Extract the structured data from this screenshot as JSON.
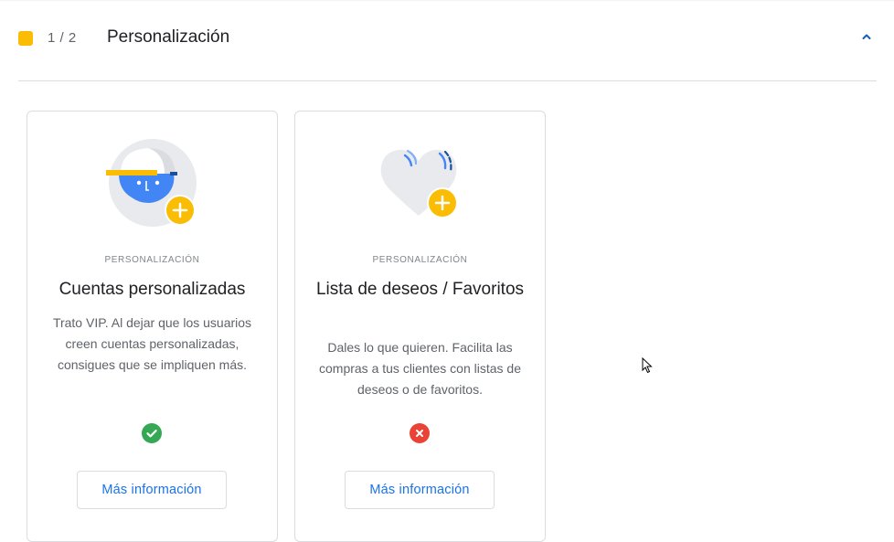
{
  "section": {
    "step_counter": "1 / 2",
    "title": "Personalización",
    "status_color": "#fbbc04"
  },
  "cards": [
    {
      "eyebrow": "PERSONALIZACIÓN",
      "title": "Cuentas personalizadas",
      "description": "Trato VIP. Al dejar que los usuarios creen cuentas personalizadas, consigues que se impliquen más.",
      "status": "check-icon",
      "status_color": "#34a853",
      "button_label": "Más información",
      "illustration": "user-account-plus-icon"
    },
    {
      "eyebrow": "PERSONALIZACIÓN",
      "title": "Lista de deseos / Favoritos",
      "description": "Dales lo que quieren. Facilita las compras a tus clientes con listas de deseos o de favoritos.",
      "status": "cross-icon",
      "status_color": "#ea4335",
      "button_label": "Más información",
      "illustration": "heart-plus-icon"
    }
  ],
  "colors": {
    "accent_blue": "#1a73e8",
    "divider": "#dadce0"
  }
}
